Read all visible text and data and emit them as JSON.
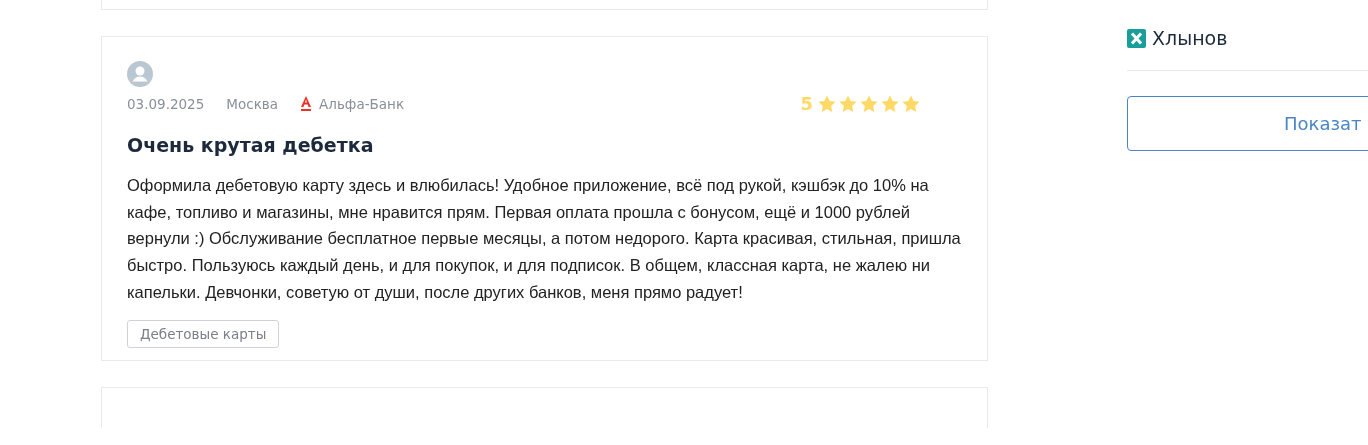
{
  "review": {
    "date": "03.09.2025",
    "city": "Москва",
    "bank": "Альфа-Банк",
    "rating": "5",
    "stars": 5,
    "title": "Очень крутая дебетка",
    "text": "Оформила дебетовую карту здесь и влюбилась! Удобное приложение, всё под рукой, кэшбэк до 10% на кафе, топливо и магазины, мне нравится прям. Первая оплата прошла с бонусом, ещё и 1000 рублей вернули :) Обслуживание бесплатное первые месяцы, а потом недорого. Карта красивая, стильная, пришла быстро. Пользуюсь каждый день, и для покупок, и для подписок. В общем, классная карта, не жалею ни капельки. Девчонки, советую от души, после других банков, меня прямо радует!",
    "tag": "Дебетовые карты"
  },
  "sidebar": {
    "bank": "Хлынов",
    "button": "Показат"
  }
}
